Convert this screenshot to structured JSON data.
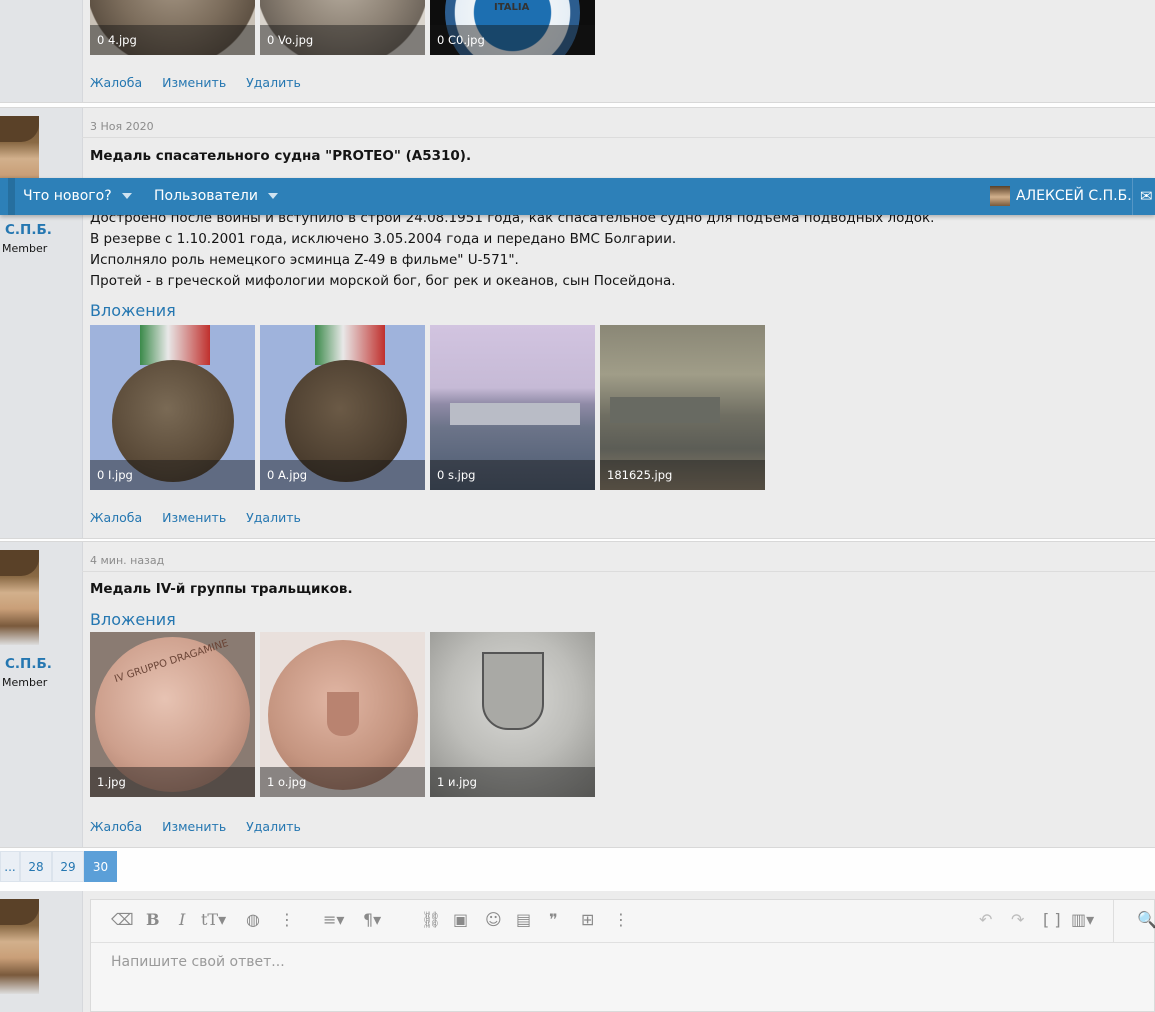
{
  "post1": {
    "attachments": [
      "0 4.jpg",
      "0 Vo.jpg",
      "0 C0.jpg"
    ],
    "actions": {
      "report": "Жалоба",
      "edit": "Изменить",
      "delete": "Удалить"
    }
  },
  "post2": {
    "date": "3 Ноя 2020",
    "title": "Медаль спасательного судна \"PROTEO\" (A5310).",
    "username": "С.П.Б.",
    "user_title": "Member",
    "lines": [
      "Достроено после войны и вступило в строй 24.08.1951 года, как спасательное судно для подъема подводных лодок.",
      "В резерве с 1.10.2001 года, исключено 3.05.2004 года и передано ВМС Болгарии.",
      "Исполняло роль немецкого эсминца Z-49 в фильме\" U-571\".",
      "Протей - в греческой мифологии морской бог, бог рек и океанов, сын Посейдона."
    ],
    "attachments_heading": "Вложения",
    "attachments": [
      "0 I.jpg",
      "0 A.jpg",
      "0 s.jpg",
      "181625.jpg"
    ],
    "actions": {
      "report": "Жалоба",
      "edit": "Изменить",
      "delete": "Удалить"
    }
  },
  "post3": {
    "date": "4 мин. назад",
    "title": "Медаль IV-й группы тральщиков.",
    "username": "С.П.Б.",
    "user_title": "Member",
    "attachments_heading": "Вложения",
    "attachments": [
      "1.jpg",
      "1 o.jpg",
      "1 и.jpg"
    ],
    "medal_text": "IV GRUPPO DRAGAMINE",
    "actions": {
      "report": "Жалоба",
      "edit": "Изменить",
      "delete": "Удалить"
    }
  },
  "navbar": {
    "whats_new": "Что нового?",
    "members": "Пользователи",
    "account": "АЛЕКСЕЙ С.П.Б."
  },
  "pagination": {
    "ellipsis": "...",
    "pages": [
      "28",
      "29",
      "30"
    ],
    "current": "30"
  },
  "editor": {
    "placeholder": "Напишите свой ответ..."
  },
  "thumb_text": {
    "italia": "ITALIA"
  },
  "colors": {
    "link": "#2577b1",
    "navbar": "#2d80b8",
    "page_active": "#5b9fd8"
  }
}
